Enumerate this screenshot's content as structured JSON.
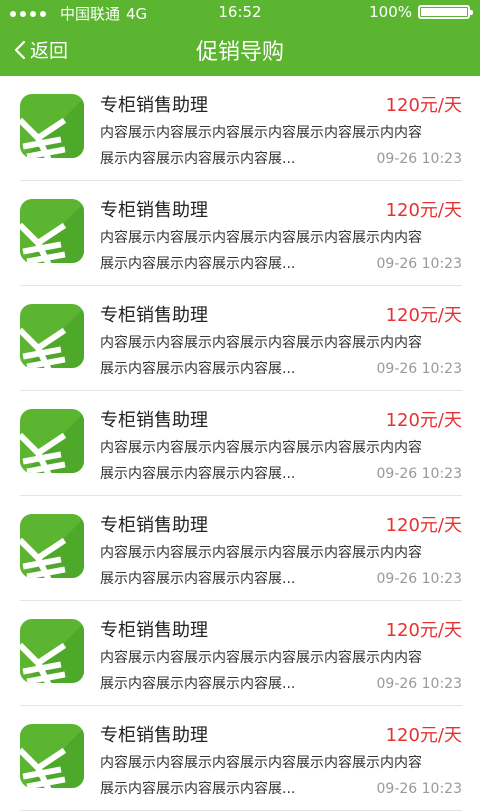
{
  "status_bar": {
    "carrier": "中国联通",
    "network": "4G",
    "time": "16:52",
    "battery_text": "100%",
    "battery_level": 1.0
  },
  "nav": {
    "back_label": "返回",
    "title": "促销导购"
  },
  "colors": {
    "brand": "#5cb531",
    "price": "#e63232",
    "muted": "#999999"
  },
  "items": [
    {
      "icon": "yen-icon",
      "title": "专柜销售助理",
      "price": "120元/天",
      "desc_line1": "内容展示内容展示内容展示内容展示内容展示内内容",
      "desc_line2": "展示内容展示内容展示内容展...",
      "date": "09-26 10:23"
    },
    {
      "icon": "yen-icon",
      "title": "专柜销售助理",
      "price": "120元/天",
      "desc_line1": "内容展示内容展示内容展示内容展示内容展示内内容",
      "desc_line2": "展示内容展示内容展示内容展...",
      "date": "09-26 10:23"
    },
    {
      "icon": "yen-icon",
      "title": "专柜销售助理",
      "price": "120元/天",
      "desc_line1": "内容展示内容展示内容展示内容展示内容展示内内容",
      "desc_line2": "展示内容展示内容展示内容展...",
      "date": "09-26 10:23"
    },
    {
      "icon": "yen-icon",
      "title": "专柜销售助理",
      "price": "120元/天",
      "desc_line1": "内容展示内容展示内容展示内容展示内容展示内内容",
      "desc_line2": "展示内容展示内容展示内容展...",
      "date": "09-26 10:23"
    },
    {
      "icon": "yen-icon",
      "title": "专柜销售助理",
      "price": "120元/天",
      "desc_line1": "内容展示内容展示内容展示内容展示内容展示内内容",
      "desc_line2": "展示内容展示内容展示内容展...",
      "date": "09-26 10:23"
    },
    {
      "icon": "yen-icon",
      "title": "专柜销售助理",
      "price": "120元/天",
      "desc_line1": "内容展示内容展示内容展示内容展示内容展示内内容",
      "desc_line2": "展示内容展示内容展示内容展...",
      "date": "09-26 10:23"
    },
    {
      "icon": "yen-icon",
      "title": "专柜销售助理",
      "price": "120元/天",
      "desc_line1": "内容展示内容展示内容展示内容展示内容展示内内容",
      "desc_line2": "展示内容展示内容展示内容展...",
      "date": "09-26 10:23"
    }
  ]
}
